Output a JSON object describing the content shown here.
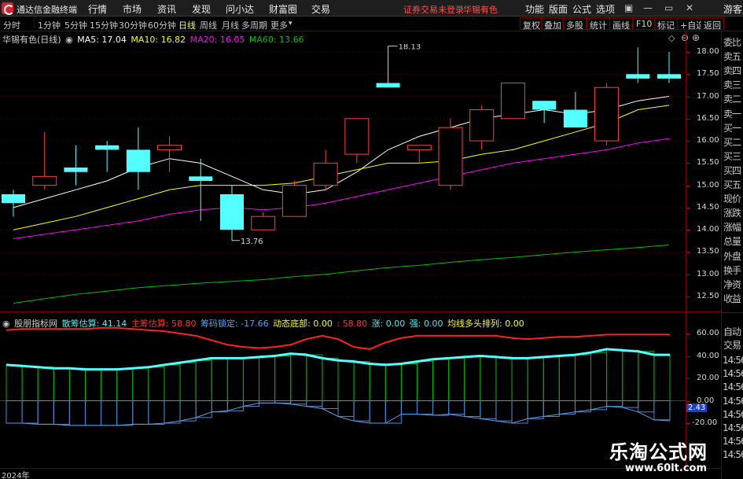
{
  "menubar": {
    "app_title": "通达信金融终端",
    "items": [
      "行情",
      "市场",
      "资讯",
      "发现",
      "问小达",
      "财富圈",
      "交易"
    ],
    "warning": "证券交易未登录",
    "stock_name": "华锡有色",
    "right_items": [
      "功能",
      "版面",
      "公式",
      "选项"
    ],
    "guest": "游客",
    "window_buttons": [
      "▣",
      "—",
      "▭",
      "✕"
    ]
  },
  "toolbar": {
    "periods": [
      "分时",
      "1分钟",
      "5分钟",
      "15分钟",
      "30分钟",
      "60分钟",
      "日线",
      "周线",
      "月线",
      "多周期",
      "更多"
    ],
    "active_period": "日线",
    "right_buttons": [
      "复权",
      "叠加",
      "多股",
      "统计",
      "画线",
      "F10",
      "标记",
      "+自选",
      "返回"
    ]
  },
  "main_legend": {
    "stock_label": "华锡有色(日线)",
    "ma5": "MA5: 17.04",
    "ma10": "MA10: 16.82",
    "ma20": "MA20: 16.05",
    "ma60": "MA60: 13.66",
    "colors": {
      "ma5": "#ffffff",
      "ma10": "#ffff00",
      "ma20": "#ff00ff",
      "ma60": "#00c000"
    }
  },
  "main_axis": {
    "ticks": [
      "18.00",
      "17.50",
      "17.00",
      "16.50",
      "16.00",
      "15.50",
      "15.00",
      "14.50",
      "14.00",
      "13.50",
      "13.00",
      "12.50"
    ],
    "high_label": "18.13",
    "low_label": "13.76"
  },
  "indicator_legend": {
    "name": "股朋指标网",
    "retail": "散筹估算: 41.14",
    "main": "主筹估算: 58.80",
    "lock": "筹码锁定: -17.66",
    "bottom": "动态底部: 0.00",
    "blank": ": 58.80",
    "up": "涨: 0.00",
    "strong": "强: 0.00",
    "ma_order": "均线多头排列: 0.00"
  },
  "indicator_axis": {
    "ticks": [
      "60.00",
      "40.00",
      "20.00",
      "0.00",
      "-20.00"
    ],
    "current_value": "2.43"
  },
  "side_panel": {
    "rows": [
      "委比",
      "卖五",
      "卖四",
      "卖三",
      "卖二",
      "卖一",
      "买一",
      "买二",
      "买三",
      "买四",
      "买五",
      "现价",
      "涨跌",
      "涨幅",
      "总量",
      "外盘",
      "换手",
      "净资",
      "收益"
    ],
    "auto_trade": [
      "自动",
      "交易"
    ],
    "times": [
      "14:56",
      "14:56",
      "14:56",
      "14:56",
      "14:56",
      "14:56",
      "14:56",
      "14:56"
    ]
  },
  "bottom": {
    "year": "2024年"
  },
  "watermark": {
    "title": "乐淘公式网",
    "url": "www.60lt.com"
  },
  "chart_data": [
    {
      "type": "candlestick",
      "title": "华锡有色(日线)",
      "x": [
        "1",
        "2",
        "3",
        "4",
        "5",
        "6",
        "7",
        "8",
        "9",
        "10",
        "11",
        "12",
        "13",
        "14",
        "15",
        "16",
        "17",
        "18",
        "19",
        "20"
      ],
      "candles": [
        {
          "o": 14.8,
          "c": 14.6,
          "h": 14.9,
          "l": 14.3
        },
        {
          "o": 15.0,
          "c": 15.2,
          "h": 16.2,
          "l": 14.9
        },
        {
          "o": 15.4,
          "c": 15.3,
          "h": 15.9,
          "l": 15.0
        },
        {
          "o": 15.9,
          "c": 15.8,
          "h": 16.0,
          "l": 15.3
        },
        {
          "o": 15.8,
          "c": 15.3,
          "h": 16.3,
          "l": 14.9
        },
        {
          "o": 15.8,
          "c": 15.9,
          "h": 16.1,
          "l": 15.3
        },
        {
          "o": 15.2,
          "c": 15.1,
          "h": 15.6,
          "l": 14.2
        },
        {
          "o": 14.8,
          "c": 14.0,
          "h": 15.0,
          "l": 13.76
        },
        {
          "o": 14.0,
          "c": 14.3,
          "h": 14.4,
          "l": 14.0
        },
        {
          "o": 14.3,
          "c": 15.0,
          "h": 15.1,
          "l": 14.3
        },
        {
          "o": 15.0,
          "c": 15.5,
          "h": 15.8,
          "l": 14.9
        },
        {
          "o": 15.7,
          "c": 16.5,
          "h": 16.5,
          "l": 15.5
        },
        {
          "o": 17.3,
          "c": 17.2,
          "h": 18.13,
          "l": 17.2
        },
        {
          "o": 15.8,
          "c": 15.9,
          "h": 15.9,
          "l": 15.5
        },
        {
          "o": 15.0,
          "c": 16.3,
          "h": 16.5,
          "l": 14.9
        },
        {
          "o": 16.0,
          "c": 16.7,
          "h": 16.8,
          "l": 15.8
        },
        {
          "o": 16.5,
          "c": 17.3,
          "h": 17.3,
          "l": 16.5
        },
        {
          "o": 16.9,
          "c": 16.7,
          "h": 16.9,
          "l": 16.4
        },
        {
          "o": 16.7,
          "c": 16.3,
          "h": 17.1,
          "l": 16.3
        },
        {
          "o": 16.0,
          "c": 17.2,
          "h": 17.3,
          "l": 15.9
        },
        {
          "o": 17.5,
          "c": 17.4,
          "h": 18.1,
          "l": 17.3
        },
        {
          "o": 17.5,
          "c": 17.4,
          "h": 18.0,
          "l": 17.3
        }
      ],
      "series": [
        {
          "name": "MA5",
          "values": [
            14.5,
            14.7,
            14.9,
            15.1,
            15.4,
            15.6,
            15.5,
            15.2,
            14.9,
            14.8,
            14.9,
            15.3,
            15.8,
            16.1,
            16.3,
            16.5,
            16.6,
            16.7,
            16.6,
            16.7,
            16.9,
            17.0
          ]
        },
        {
          "name": "MA10",
          "values": [
            14.0,
            14.15,
            14.3,
            14.5,
            14.7,
            14.9,
            15.0,
            15.0,
            15.0,
            15.05,
            15.2,
            15.35,
            15.5,
            15.5,
            15.55,
            15.7,
            15.8,
            16.0,
            16.2,
            16.4,
            16.7,
            16.8
          ]
        },
        {
          "name": "MA20",
          "values": [
            13.8,
            13.9,
            14.0,
            14.1,
            14.2,
            14.35,
            14.45,
            14.5,
            14.45,
            14.5,
            14.6,
            14.75,
            14.9,
            15.05,
            15.2,
            15.35,
            15.5,
            15.6,
            15.7,
            15.8,
            15.95,
            16.05
          ]
        },
        {
          "name": "MA60",
          "values": [
            12.35,
            12.45,
            12.55,
            12.62,
            12.7,
            12.75,
            12.8,
            12.84,
            12.88,
            12.95,
            13.0,
            13.08,
            13.15,
            13.2,
            13.27,
            13.33,
            13.38,
            13.44,
            13.5,
            13.55,
            13.6,
            13.66
          ]
        }
      ],
      "ylim": [
        12.3,
        18.3
      ]
    },
    {
      "type": "bar",
      "title": "股朋指标网",
      "x": [
        "1",
        "2",
        "3",
        "4",
        "5",
        "6",
        "7",
        "8",
        "9",
        "10",
        "11",
        "12",
        "13",
        "14",
        "15",
        "16",
        "17",
        "18",
        "19",
        "20",
        "21",
        "22",
        "23",
        "24",
        "25",
        "26",
        "27",
        "28",
        "29",
        "30",
        "31",
        "32",
        "33",
        "34",
        "35",
        "36",
        "37",
        "38",
        "39",
        "40",
        "41",
        "42",
        "43"
      ],
      "series": [
        {
          "name": "散筹估算",
          "values": [
            32,
            31,
            30,
            29,
            29,
            28,
            28,
            28,
            29,
            30,
            32,
            34,
            36,
            38,
            38,
            38,
            39,
            40,
            42,
            41,
            38,
            36,
            35,
            33,
            32,
            33,
            35,
            37,
            38,
            39,
            40,
            39,
            38,
            38,
            39,
            40,
            41,
            43,
            46,
            45,
            44,
            41,
            41
          ]
        },
        {
          "name": "筹码锁定",
          "values": [
            -20,
            -20,
            -21,
            -21,
            -22,
            -22,
            -22,
            -22,
            -21,
            -21,
            -20,
            -18,
            -15,
            -10,
            -9,
            -5,
            -2,
            -2,
            -3,
            -5,
            -7,
            -14,
            -18,
            -20,
            -20,
            -12,
            -12,
            -13,
            -12,
            -14,
            -16,
            -18,
            -20,
            -16,
            -14,
            -12,
            -10,
            -8,
            -5,
            -6,
            -10,
            -17,
            -18
          ]
        },
        {
          "name": "主筹估算",
          "values": [
            63,
            64,
            64,
            64,
            64,
            64,
            65,
            65,
            64,
            63,
            62,
            60,
            58,
            54,
            50,
            48,
            47,
            48,
            50,
            55,
            58,
            55,
            48,
            46,
            52,
            56,
            58,
            58,
            58,
            58,
            58,
            58,
            56,
            55,
            56,
            57,
            57,
            58,
            59,
            59,
            59,
            59,
            59
          ]
        }
      ],
      "ylim": [
        -22,
        66
      ]
    }
  ]
}
